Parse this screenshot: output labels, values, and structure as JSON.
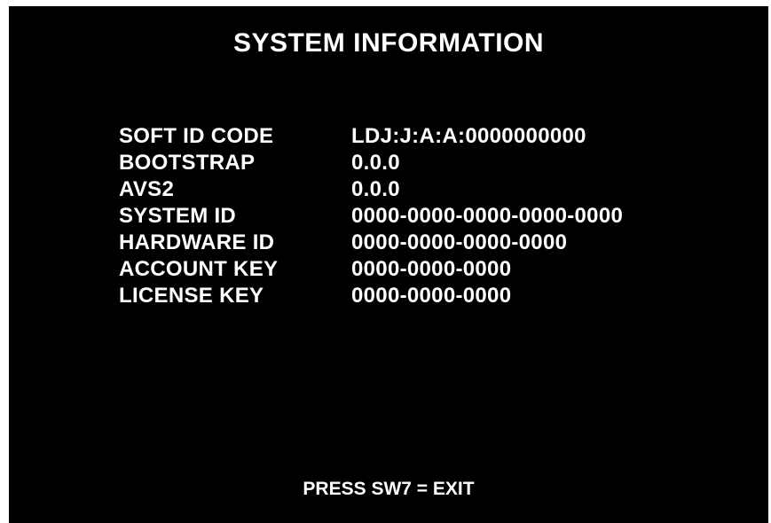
{
  "screen": {
    "title": "SYSTEM INFORMATION",
    "rows": [
      {
        "label": "SOFT ID CODE",
        "value": "LDJ:J:A:A:0000000000"
      },
      {
        "label": "BOOTSTRAP",
        "value": "0.0.0"
      },
      {
        "label": "AVS2",
        "value": "0.0.0"
      },
      {
        "label": "SYSTEM ID",
        "value": "0000-0000-0000-0000-0000"
      },
      {
        "label": "HARDWARE ID",
        "value": "0000-0000-0000-0000"
      },
      {
        "label": "ACCOUNT KEY",
        "value": "0000-0000-0000"
      },
      {
        "label": "LICENSE KEY",
        "value": "0000-0000-0000"
      }
    ],
    "footer": "PRESS SW7 = EXIT"
  },
  "colors": {
    "background": "#000000",
    "text": "#ffffff",
    "frame": "#ffffff"
  }
}
